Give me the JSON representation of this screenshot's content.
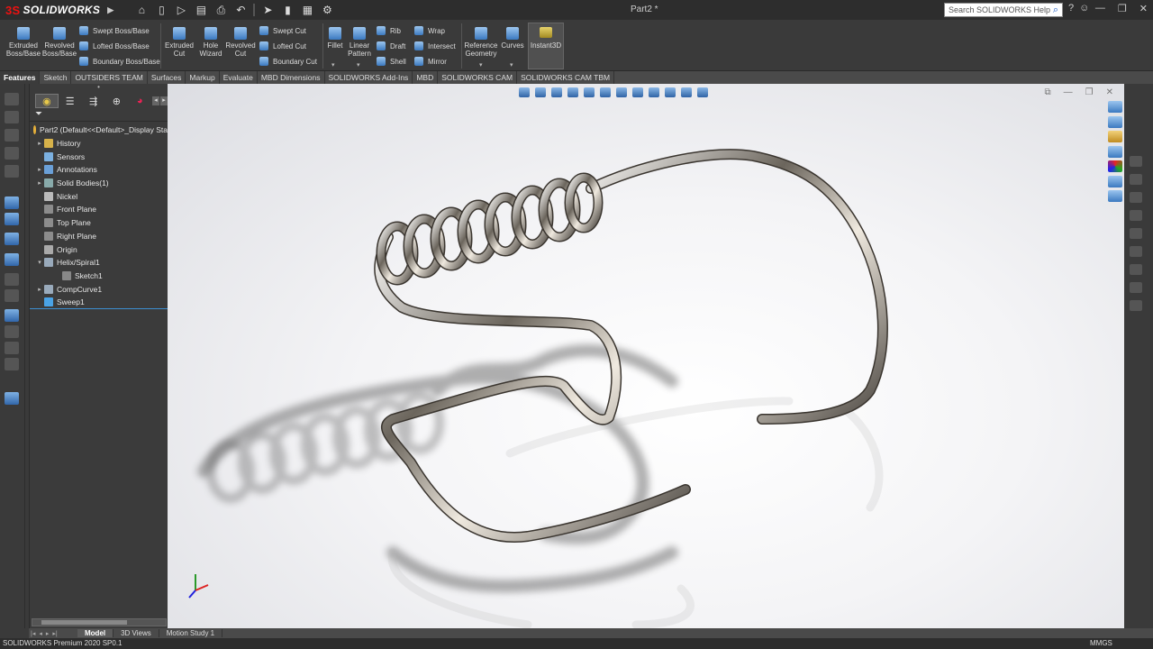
{
  "app": {
    "brand_prefix": "3S",
    "brand_name": "SOLIDWORKS",
    "document_title": "Part2 *",
    "search_placeholder": "Search SOLIDWORKS Help"
  },
  "ribbon": {
    "buttons": [
      {
        "label": "Extruded Boss/Base"
      },
      {
        "label": "Revolved Boss/Base"
      },
      {
        "label": "Extruded Cut"
      },
      {
        "label": "Hole Wizard"
      },
      {
        "label": "Revolved Cut"
      },
      {
        "label": "Fillet"
      },
      {
        "label": "Linear Pattern"
      },
      {
        "label": "Reference Geometry"
      },
      {
        "label": "Curves"
      },
      {
        "label": "Instant3D"
      }
    ],
    "small": [
      {
        "label": "Swept Boss/Base"
      },
      {
        "label": "Lofted Boss/Base"
      },
      {
        "label": "Boundary Boss/Base"
      },
      {
        "label": "Swept Cut"
      },
      {
        "label": "Lofted Cut"
      },
      {
        "label": "Boundary Cut"
      },
      {
        "label": "Rib"
      },
      {
        "label": "Draft"
      },
      {
        "label": "Shell"
      },
      {
        "label": "Wrap"
      },
      {
        "label": "Intersect"
      },
      {
        "label": "Mirror"
      }
    ]
  },
  "tabs": [
    "Features",
    "Sketch",
    "OUTSIDERS TEAM",
    "Surfaces",
    "Markup",
    "Evaluate",
    "MBD Dimensions",
    "SOLIDWORKS Add-Ins",
    "MBD",
    "SOLIDWORKS CAM",
    "SOLIDWORKS CAM TBM"
  ],
  "tree": {
    "root": "Part2  (Default<<Default>_Display Sta",
    "items": [
      {
        "label": "History",
        "icon": "history-icon",
        "expand": true
      },
      {
        "label": "Sensors",
        "icon": "sensors-icon",
        "expand": false
      },
      {
        "label": "Annotations",
        "icon": "annotations-icon",
        "expand": true
      },
      {
        "label": "Solid Bodies(1)",
        "icon": "solid-bodies-icon",
        "expand": true
      },
      {
        "label": "Nickel",
        "icon": "material-icon",
        "expand": false
      },
      {
        "label": "Front Plane",
        "icon": "plane-icon",
        "expand": false
      },
      {
        "label": "Top Plane",
        "icon": "plane-icon",
        "expand": false
      },
      {
        "label": "Right Plane",
        "icon": "plane-icon",
        "expand": false
      },
      {
        "label": "Origin",
        "icon": "origin-icon",
        "expand": false
      },
      {
        "label": "Helix/Spiral1",
        "icon": "helix-icon",
        "expand": true
      },
      {
        "label": "Sketch1",
        "icon": "sketch-icon",
        "expand": false
      },
      {
        "label": "CompCurve1",
        "icon": "composite-curve-icon",
        "expand": true
      },
      {
        "label": "Sweep1",
        "icon": "sweep-icon",
        "expand": false
      }
    ]
  },
  "bottom_tabs": [
    "Model",
    "3D Views",
    "Motion Study 1"
  ],
  "status": {
    "left": "SOLIDWORKS Premium 2020 SP0.1",
    "units": "MMGS"
  },
  "colors": {
    "accent": "#3d8fd1",
    "brand_red": "#e11111"
  }
}
